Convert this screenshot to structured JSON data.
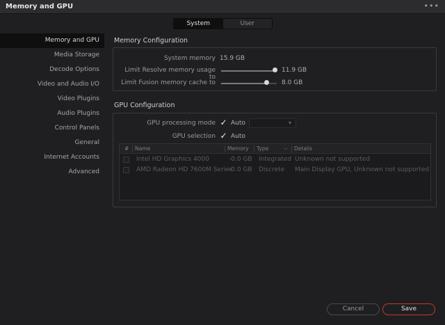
{
  "window": {
    "title": "Memory and GPU",
    "menu_glyph": "•••"
  },
  "tabs": [
    {
      "label": "System",
      "active": true
    },
    {
      "label": "User",
      "active": false
    }
  ],
  "sidebar": {
    "items": [
      {
        "label": "Memory and GPU",
        "active": true
      },
      {
        "label": "Media Storage"
      },
      {
        "label": "Decode Options"
      },
      {
        "label": "Video and Audio I/O"
      },
      {
        "label": "Video Plugins"
      },
      {
        "label": "Audio Plugins"
      },
      {
        "label": "Control Panels"
      },
      {
        "label": "General"
      },
      {
        "label": "Internet Accounts"
      },
      {
        "label": "Advanced"
      }
    ]
  },
  "memory": {
    "section_title": "Memory Configuration",
    "system_memory_label": "System memory",
    "system_memory_value": "15.9 GB",
    "resolve_limit_label": "Limit Resolve memory usage to",
    "resolve_limit_value": "11.9 GB",
    "resolve_limit_fraction": 0.97,
    "fusion_limit_label": "Limit Fusion memory cache to",
    "fusion_limit_value": "8.0 GB",
    "fusion_limit_fraction": 0.82
  },
  "gpu": {
    "section_title": "GPU Configuration",
    "processing_mode_label": "GPU processing mode",
    "processing_mode_auto": "Auto",
    "processing_mode_checked": true,
    "selection_label": "GPU selection",
    "selection_auto": "Auto",
    "selection_checked": true,
    "table": {
      "headers": {
        "index": "#",
        "name": "Name",
        "memory": "Memory",
        "type": "Type",
        "details": "Details"
      },
      "rows": [
        {
          "name": "Intel HD Graphics 4000",
          "memory": "-0.0 GB",
          "type": "Integrated",
          "details": "Unknown not supported"
        },
        {
          "name": "AMD Radeon HD 7600M Series",
          "memory": "-0.0 GB",
          "type": "Discrete",
          "details": "Main Display GPU, Unknown not supported"
        }
      ]
    }
  },
  "buttons": {
    "cancel": "Cancel",
    "save": "Save"
  },
  "colors": {
    "accent_save_border": "#c0392b",
    "background": "#1f1f21"
  }
}
